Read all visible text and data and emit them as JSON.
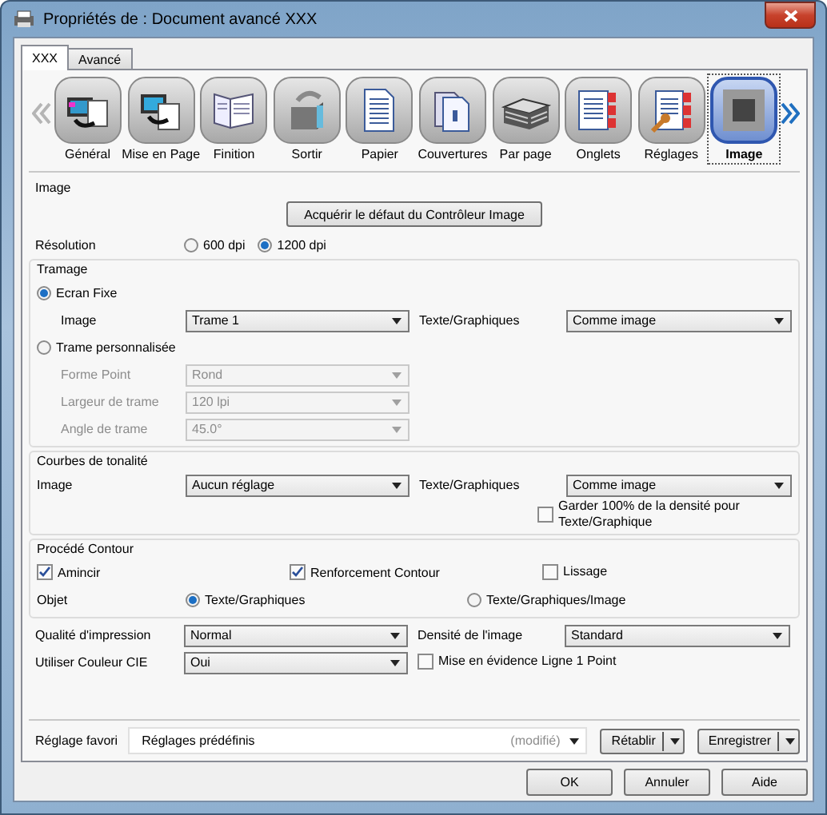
{
  "window": {
    "title": "Propriétés de : Document avancé XXX"
  },
  "tabs": [
    {
      "label": "XXX",
      "selected": true
    },
    {
      "label": "Avancé",
      "selected": false
    }
  ],
  "categories": [
    {
      "label": "Général",
      "selected": false
    },
    {
      "label": "Mise en Page",
      "selected": false
    },
    {
      "label": "Finition",
      "selected": false
    },
    {
      "label": "Sortir",
      "selected": false
    },
    {
      "label": "Papier",
      "selected": false
    },
    {
      "label": "Couvertures",
      "selected": false
    },
    {
      "label": "Par page",
      "selected": false
    },
    {
      "label": "Onglets",
      "selected": false
    },
    {
      "label": "Réglages",
      "selected": false
    },
    {
      "label": "Image",
      "selected": true
    }
  ],
  "image": {
    "title": "Image",
    "default_button": "Acquérir le défaut du Contrôleur Image",
    "resolution": {
      "label": "Résolution",
      "options": [
        {
          "label": "600 dpi",
          "selected": false
        },
        {
          "label": "1200 dpi",
          "selected": true
        }
      ]
    },
    "tramage": {
      "title": "Tramage",
      "fixed": {
        "label": "Ecran Fixe",
        "selected": true,
        "image_label": "Image",
        "image_value": "Trame 1",
        "text_label": "Texte/Graphiques",
        "text_value": "Comme image"
      },
      "custom": {
        "label": "Trame personnalisée",
        "selected": false,
        "fields": [
          {
            "label": "Forme Point",
            "value": "Rond",
            "disabled": true
          },
          {
            "label": "Largeur de trame",
            "value": "120 lpi",
            "disabled": true
          },
          {
            "label": "Angle de trame",
            "value": "45.0°",
            "disabled": true
          }
        ]
      }
    },
    "courbes": {
      "title": "Courbes de tonalité",
      "image_label": "Image",
      "image_value": "Aucun réglage",
      "text_label": "Texte/Graphiques",
      "text_value": "Comme image",
      "keep_density": {
        "label": "Garder 100% de la densité pour Texte/Graphique",
        "checked": false
      }
    },
    "contour": {
      "title": "Procédé Contour",
      "checks": [
        {
          "label": "Amincir",
          "checked": true
        },
        {
          "label": "Renforcement Contour",
          "checked": true
        },
        {
          "label": "Lissage",
          "checked": false
        }
      ],
      "object_label": "Objet",
      "object_options": [
        {
          "label": "Texte/Graphiques",
          "selected": true
        },
        {
          "label": "Texte/Graphiques/Image",
          "selected": false
        }
      ]
    },
    "quality": {
      "label": "Qualité d'impression",
      "value": "Normal"
    },
    "density": {
      "label": "Densité de l'image",
      "value": "Standard"
    },
    "cie": {
      "label": "Utiliser Couleur CIE",
      "value": "Oui"
    },
    "line_highlight": {
      "label": "Mise en évidence Ligne 1 Point",
      "checked": false
    }
  },
  "favorite": {
    "label": "Réglage favori",
    "value": "Réglages prédéfinis",
    "note": "(modifié)",
    "buttons": [
      "Rétablir",
      "Enregistrer"
    ]
  },
  "buttons": [
    "OK",
    "Annuler",
    "Aide"
  ]
}
